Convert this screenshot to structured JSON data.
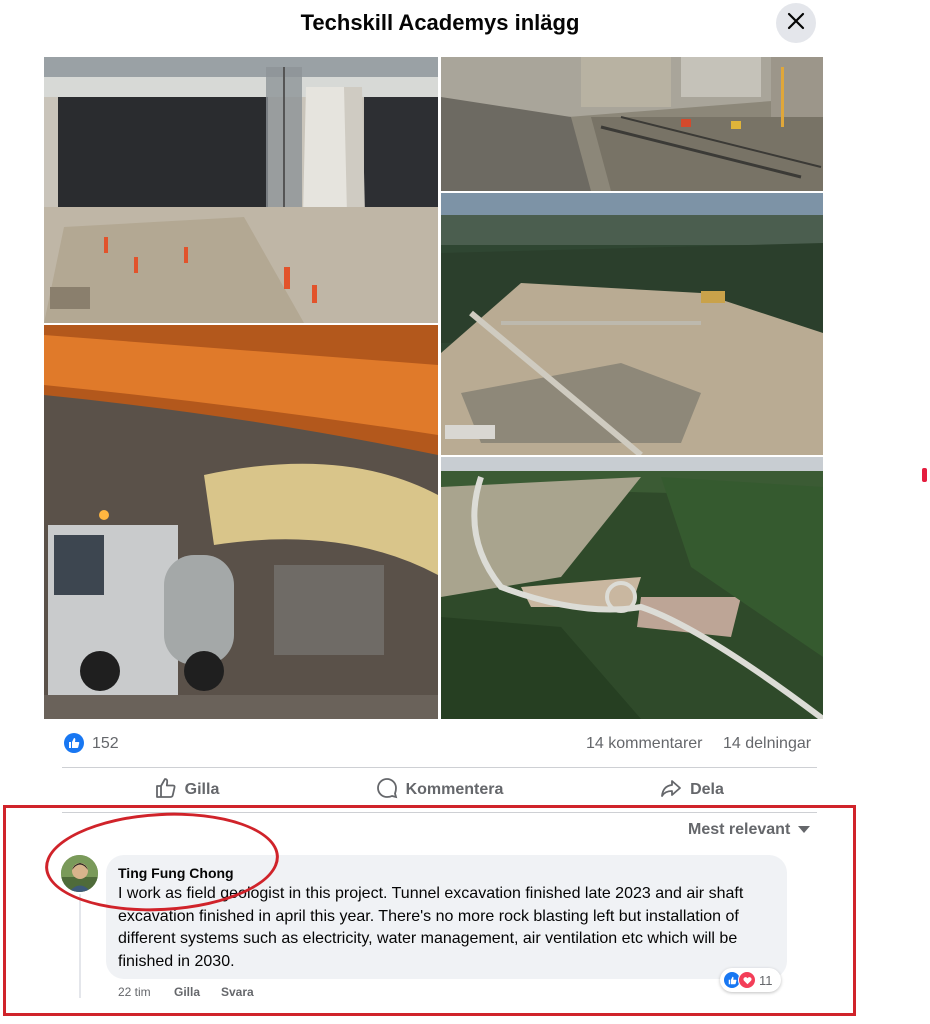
{
  "header": {
    "title": "Techskill Academys inlägg",
    "close_icon": "close-icon"
  },
  "photos": [
    {
      "name": "tunnel-portal-photo"
    },
    {
      "name": "construction-site-photo"
    },
    {
      "name": "aerial-conveyor-photo"
    },
    {
      "name": "underground-tunnel-truck-photo"
    },
    {
      "name": "aerial-road-forest-photo"
    }
  ],
  "stats": {
    "like_count": "152",
    "comments": "14 kommentarer",
    "shares": "14 delningar"
  },
  "actions": {
    "like": "Gilla",
    "comment": "Kommentera",
    "share": "Dela"
  },
  "comments_section": {
    "sort_label": "Mest relevant",
    "comment": {
      "author": "Ting Fung Chong",
      "text": "I work as field geologist in this project. Tunnel excavation finished late 2023 and air shaft excavation finished in april this year. There's no more rock blasting left but installation of different systems such as electricity, water management, air ventilation etc which will be finished in 2030.",
      "time": "22 tim",
      "like_label": "Gilla",
      "reply_label": "Svara",
      "reaction_count": "11"
    }
  },
  "colors": {
    "accent_blue": "#1877f2",
    "love_red": "#f33e58",
    "annotation_red": "#d0232a",
    "muted_text": "#65676b",
    "bubble_bg": "#f0f2f5"
  }
}
